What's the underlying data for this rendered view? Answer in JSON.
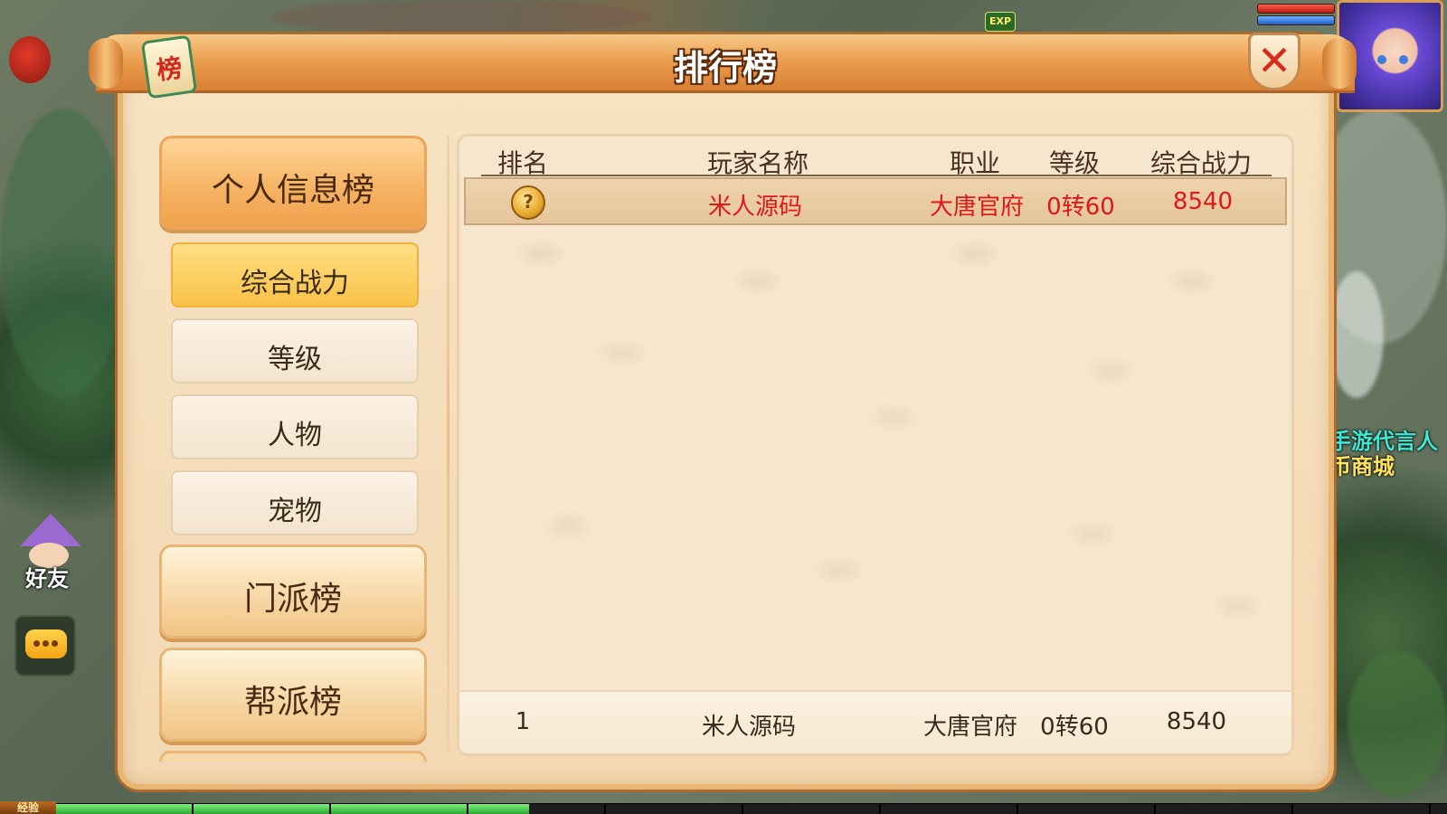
{
  "title": "排行榜",
  "title_icon_char": "榜",
  "close_symbol": "✕",
  "hud": {
    "exp_badge": "EXP",
    "exp_label": "经验",
    "exp_progress": 0.34,
    "friend_label": "好友",
    "side_text_1": "手游代言人",
    "side_text_2": "币商城"
  },
  "menu": {
    "personal": "个人信息榜",
    "sub": [
      "综合战力",
      "等级",
      "人物",
      "宠物"
    ],
    "sect": "门派榜",
    "guild": "帮派榜",
    "active_sub_index": 0
  },
  "table": {
    "headers": [
      "排名",
      "玩家名称",
      "职业",
      "等级",
      "综合战力"
    ],
    "rows": [
      {
        "rank_icon": "gold-medal-icon",
        "rank_badge": "?",
        "name": "米人源码",
        "job": "大唐官府",
        "level": "0转60",
        "power": "8540"
      }
    ],
    "self_row": {
      "rank": "1",
      "name": "米人源码",
      "job": "大唐官府",
      "level": "0转60",
      "power": "8540"
    }
  },
  "colors": {
    "accent": "#e89848",
    "highlight_text": "#e01818",
    "active_tab": "#f8c247",
    "panel_bg": "#f6e6cd"
  }
}
